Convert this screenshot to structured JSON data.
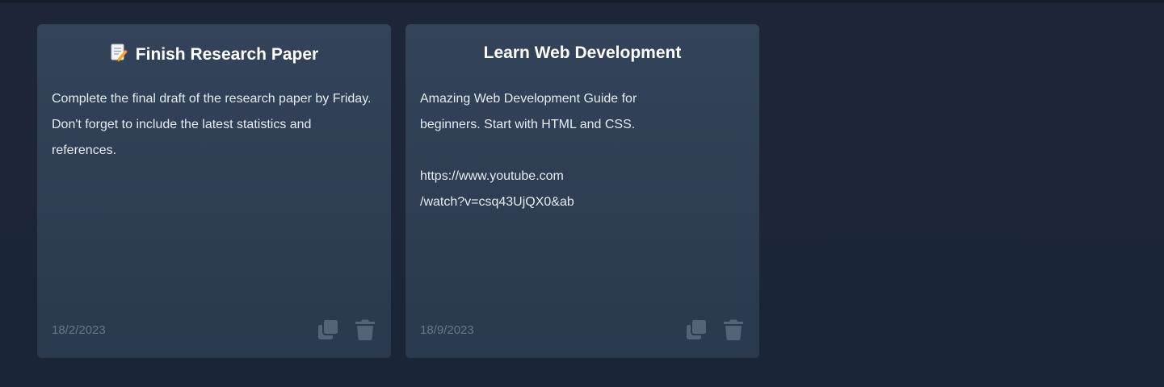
{
  "notes": [
    {
      "title": "Finish Research Paper",
      "icon": "memo-pencil-icon",
      "body": "Complete the final draft of the research paper by Friday. Don't forget to include the latest statistics and references.",
      "date": "18/2/2023"
    },
    {
      "title": "Learn Web Development",
      "body": "Amazing Web Development Guide for\nbeginners. Start with HTML and CSS.\n\nhttps://www.youtube.com\n/watch?v=csq43UjQX0&ab",
      "date": "18/9/2023"
    }
  ],
  "actions": {
    "copy_icon": "copy-icon",
    "delete_icon": "trash-icon"
  },
  "colors": {
    "background": "#1b2537",
    "card": "#334359",
    "title": "#ffffff",
    "body": "#e6ebf2",
    "muted": "#67758a"
  }
}
